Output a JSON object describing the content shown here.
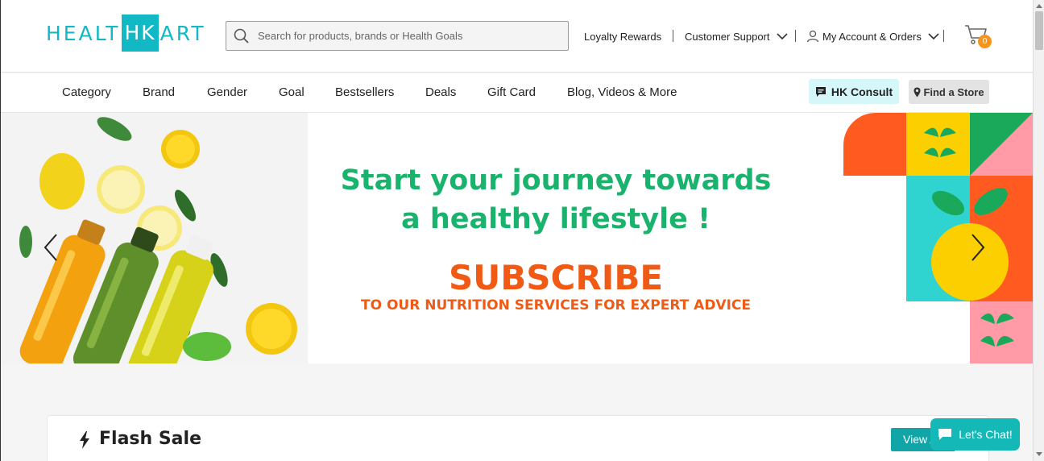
{
  "header": {
    "logo": {
      "pre": "HEALT",
      "box": "HK",
      "post": "ART"
    },
    "search": {
      "placeholder": "Search for products, brands or Health Goals",
      "value": ""
    },
    "nav": {
      "loyalty": "Loyalty Rewards",
      "support": "Customer Support",
      "account": "My Account & Orders"
    },
    "cart_count": "0"
  },
  "categories": [
    "Category",
    "Brand",
    "Gender",
    "Goal",
    "Bestsellers",
    "Deals",
    "Gift Card",
    "Blog, Videos & More"
  ],
  "actions": {
    "consult": "HK Consult",
    "store": "Find a Store"
  },
  "banner": {
    "line1": "Start your journey towards",
    "line2": "a healthy lifestyle !",
    "cta": "SUBSCRIBE",
    "cta_sub": "TO OUR NUTRITION SERVICES FOR EXPERT ADVICE"
  },
  "flash_sale": {
    "title": "Flash Sale",
    "view_all": "View All"
  },
  "chat": {
    "label": "Let's Chat!"
  },
  "colors": {
    "brand": "#12b8c4",
    "green": "#1ab36e",
    "orange": "#f05a14",
    "chat": "#14b8b6"
  }
}
